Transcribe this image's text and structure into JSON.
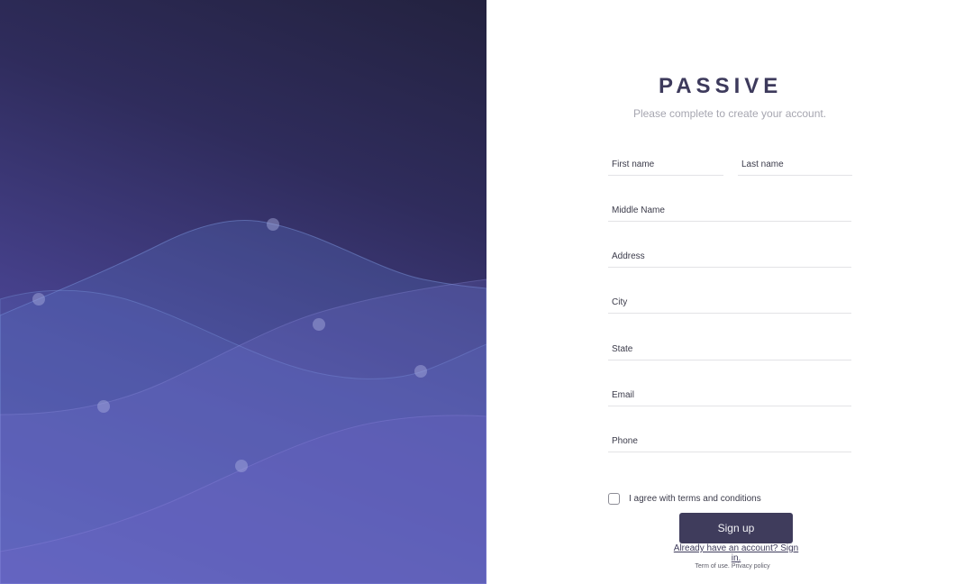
{
  "brand": {
    "name": "PASSIVE"
  },
  "form": {
    "subtitle": "Please complete to create your account.",
    "first_name_placeholder": "First name",
    "last_name_placeholder": "Last name",
    "middle_name_placeholder": "Middle Name",
    "address_placeholder": "Address",
    "city_placeholder": "City",
    "state_placeholder": "State",
    "email_placeholder": "Email",
    "phone_placeholder": "Phone",
    "terms_label": "I agree with terms and conditions",
    "submit_label": "Sign up",
    "signin_link": "Already have an account? Sign in.",
    "terms_of_use": "Term of use.",
    "privacy_policy": "Privacy policy"
  },
  "colors": {
    "hero_dark": "#23223f",
    "hero_light": "#5b55b0",
    "button": "#3f3c5c",
    "brand_text": "#3d3a5c"
  }
}
